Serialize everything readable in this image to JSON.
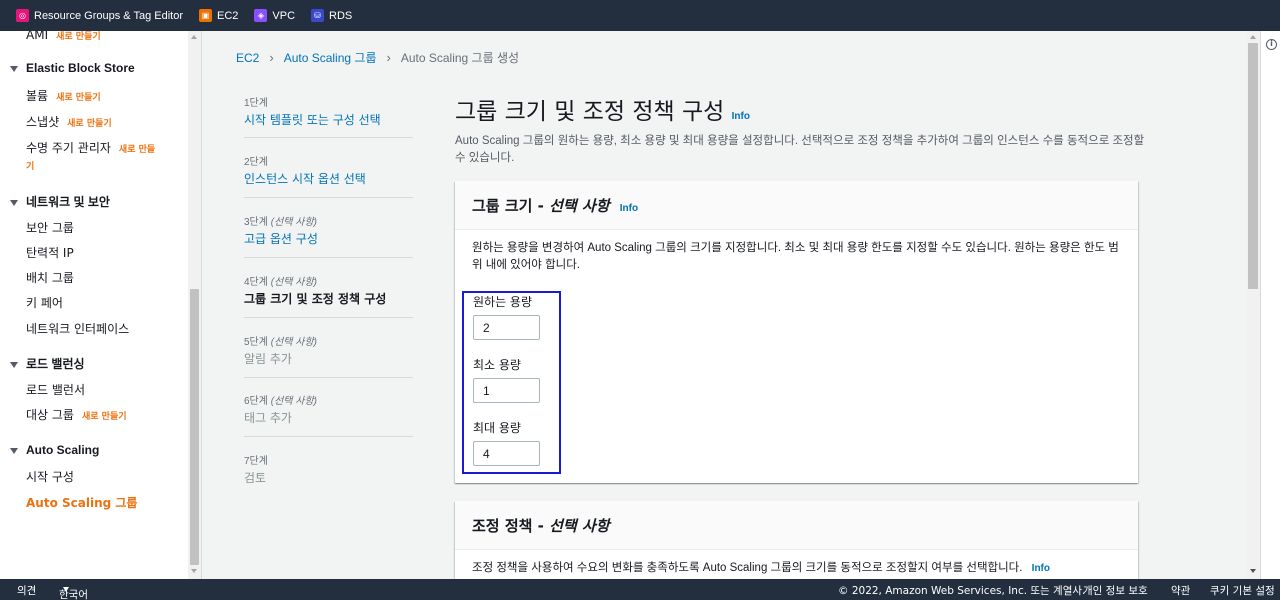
{
  "topbar": {
    "services": [
      {
        "label": "Resource Groups & Tag Editor",
        "icon": "resource-groups-icon",
        "color": "#e7157b"
      },
      {
        "label": "EC2",
        "icon": "ec2-icon",
        "color": "#ed7100"
      },
      {
        "label": "VPC",
        "icon": "vpc-icon",
        "color": "#8c4fff"
      },
      {
        "label": "RDS",
        "icon": "rds-icon",
        "color": "#3b48cc"
      }
    ]
  },
  "sidebar": {
    "new_label": "새로 만들기",
    "ami": "AMI",
    "ebs": {
      "title": "Elastic Block Store",
      "items": [
        "볼륨",
        "스냅샷",
        "수명 주기 관리자"
      ],
      "lifecycle_new_line2": "기"
    },
    "network": {
      "title": "네트워크 및 보안",
      "items": [
        "보안 그룹",
        "탄력적 IP",
        "배치 그룹",
        "키 페어",
        "네트워크 인터페이스"
      ]
    },
    "lb": {
      "title": "로드 밸런싱",
      "items": [
        "로드 밸런서",
        "대상 그룹"
      ]
    },
    "asg": {
      "title": "Auto Scaling",
      "items": [
        "시작 구성",
        "Auto Scaling 그룹"
      ]
    },
    "lifecycle_new_short": "새로 만들"
  },
  "breadcrumb": {
    "ec2": "EC2",
    "asg": "Auto Scaling 그룹",
    "current": "Auto Scaling 그룹 생성"
  },
  "steps": [
    {
      "num": "1단계",
      "optional": "",
      "label": "시작 템플릿 또는 구성 선택"
    },
    {
      "num": "2단계",
      "optional": "",
      "label": "인스턴스 시작 옵션 선택"
    },
    {
      "num": "3단계",
      "optional": "(선택 사항)",
      "label": "고급 옵션 구성"
    },
    {
      "num": "4단계",
      "optional": "(선택 사항)",
      "label": "그룹 크기 및 조정 정책 구성"
    },
    {
      "num": "5단계",
      "optional": "(선택 사항)",
      "label": "알림 추가"
    },
    {
      "num": "6단계",
      "optional": "(선택 사항)",
      "label": "태그 추가"
    },
    {
      "num": "7단계",
      "optional": "",
      "label": "검토"
    }
  ],
  "page": {
    "title": "그룹 크기 및 조정 정책 구성",
    "info": "Info",
    "description": "Auto Scaling 그룹의 원하는 용량, 최소 용량 및 최대 용량을 설정합니다. 선택적으로 조정 정책을 추가하여 그룹의 인스턴스 수를 동적으로 조정할 수 있습니다."
  },
  "group_size": {
    "title": "그룹 크기 - ",
    "title_optional": "선택 사항",
    "info": "Info",
    "description": "원하는 용량을 변경하여 Auto Scaling 그룹의 크기를 지정합니다. 최소 및 최대 용량 한도를 지정할 수도 있습니다. 원하는 용량은 한도 범위 내에 있어야 합니다.",
    "desired_label": "원하는 용량",
    "desired_value": "2",
    "min_label": "최소 용량",
    "min_value": "1",
    "max_label": "최대 용량",
    "max_value": "4"
  },
  "scaling_policy": {
    "title": "조정 정책 - ",
    "title_optional": "선택 사항",
    "description": "조정 정책을 사용하여 수요의 변화를 충족하도록 Auto Scaling 그룹의 크기를 동적으로 조정할지 여부를 선택합니다.",
    "info": "Info"
  },
  "footer": {
    "feedback": "의견",
    "language": "한국어",
    "copyright": "© 2022, Amazon Web Services, Inc. 또는 계열사.",
    "privacy": "개인 정보 보호",
    "terms": "약관",
    "cookies": "쿠키 기본 설정"
  }
}
